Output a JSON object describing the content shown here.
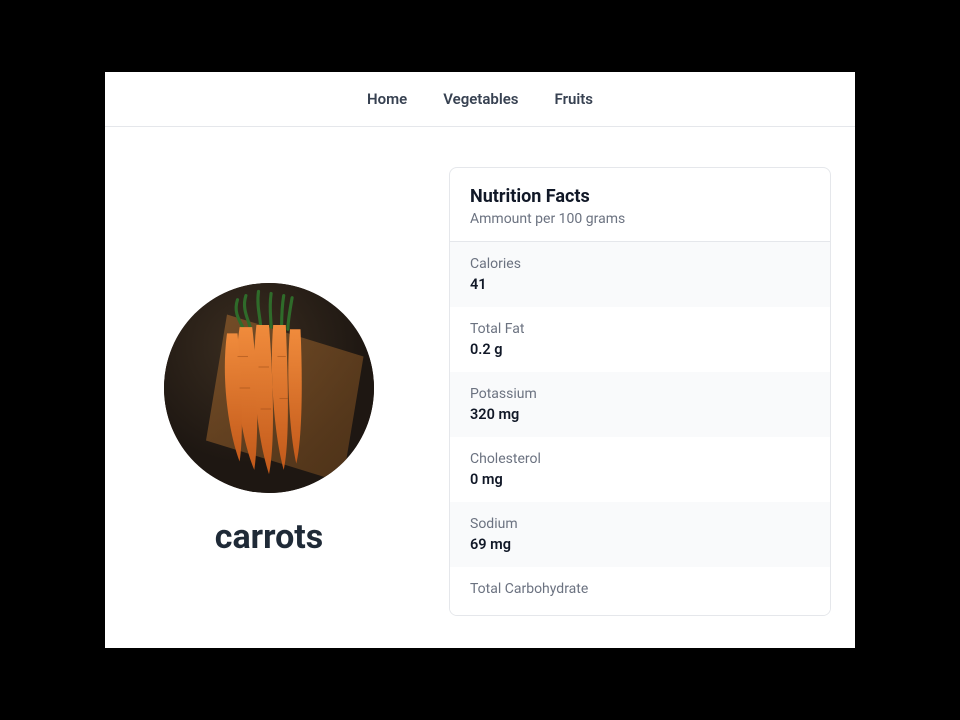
{
  "nav": {
    "items": [
      {
        "label": "Home"
      },
      {
        "label": "Vegetables"
      },
      {
        "label": "Fruits"
      }
    ]
  },
  "product": {
    "name": "carrots",
    "image_alt": "carrots"
  },
  "nutrition": {
    "title": "Nutrition Facts",
    "subtitle": "Ammount per 100 grams",
    "facts": [
      {
        "label": "Calories",
        "value": "41"
      },
      {
        "label": "Total Fat",
        "value": "0.2 g"
      },
      {
        "label": "Potassium",
        "value": "320 mg"
      },
      {
        "label": "Cholesterol",
        "value": "0 mg"
      },
      {
        "label": "Sodium",
        "value": "69 mg"
      },
      {
        "label": "Total Carbohydrate",
        "value": ""
      }
    ]
  }
}
